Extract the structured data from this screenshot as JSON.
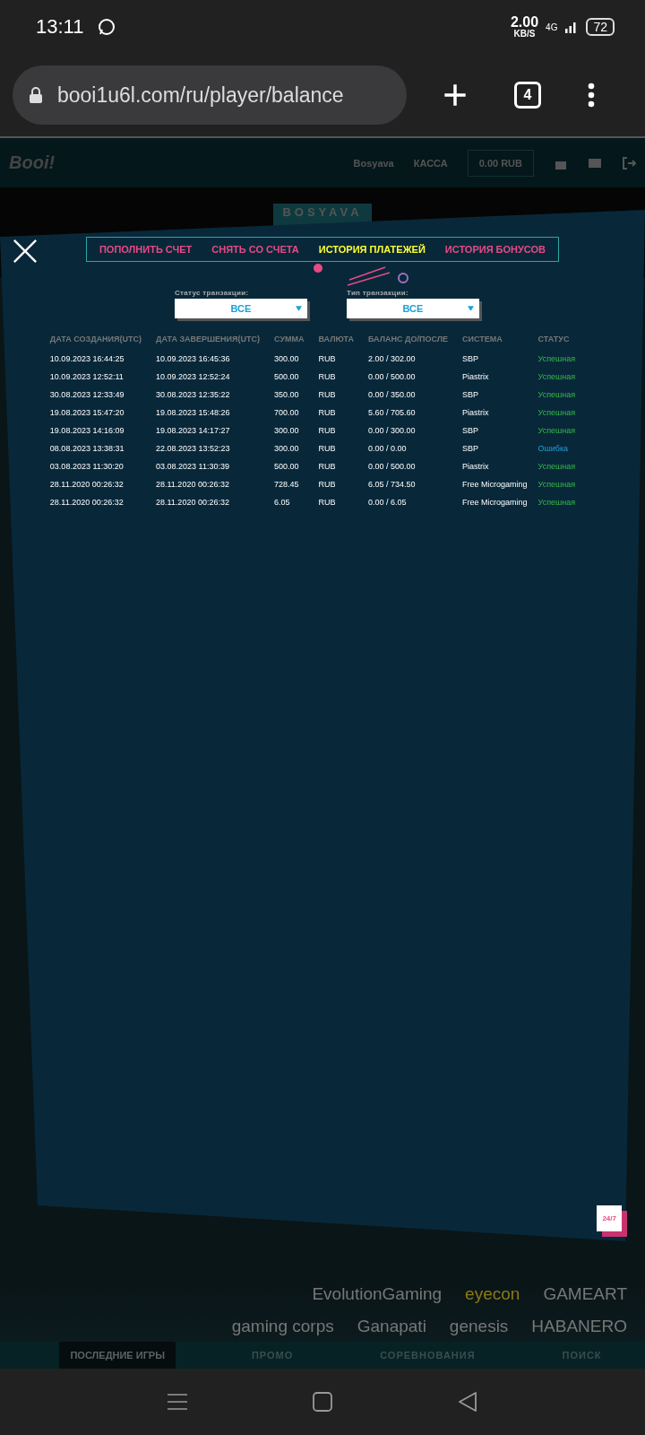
{
  "status_bar": {
    "time": "13:11",
    "speed": "2.00",
    "speed_unit": "KB/S",
    "network": "4G",
    "battery": "72"
  },
  "browser": {
    "url": "booi1u6l.com/ru/player/balance",
    "tab_count": "4"
  },
  "header": {
    "logo": "Booi!",
    "user": "Bosyava",
    "cashier": "КАССА",
    "balance": "0.00 RUB"
  },
  "banner": {
    "title": "BOSYAVA"
  },
  "modal": {
    "tabs": [
      {
        "label": "ПОПОЛНИТЬ СЧЕТ",
        "selected": false
      },
      {
        "label": "СНЯТЬ СО СЧЕТА",
        "selected": false
      },
      {
        "label": "ИСТОРИЯ ПЛАТЕЖЕЙ",
        "selected": true
      },
      {
        "label": "ИСТОРИЯ БОНУСОВ",
        "selected": false
      }
    ],
    "filters": [
      {
        "label": "Статус транзакции:",
        "value": "ВСЕ"
      },
      {
        "label": "Тип транзакции:",
        "value": "ВСЕ"
      }
    ],
    "table": {
      "columns": [
        "ДАТА СОЗДАНИЯ(UTC)",
        "ДАТА ЗАВЕРШЕНИЯ(UTC)",
        "СУММА",
        "ВАЛЮТА",
        "БАЛАНС ДО/ПОСЛЕ",
        "СИСТЕМА",
        "СТАТУС"
      ],
      "rows": [
        {
          "cells": [
            "10.09.2023 16:44:25",
            "10.09.2023 16:45:36",
            "300.00",
            "RUB",
            "2.00 / 302.00",
            "SBP",
            "Успешная"
          ],
          "kind": "success"
        },
        {
          "cells": [
            "10.09.2023 12:52:11",
            "10.09.2023 12:52:24",
            "500.00",
            "RUB",
            "0.00 / 500.00",
            "Piastrix",
            "Успешная"
          ],
          "kind": "success"
        },
        {
          "cells": [
            "30.08.2023 12:33:49",
            "30.08.2023 12:35:22",
            "350.00",
            "RUB",
            "0.00 / 350.00",
            "SBP",
            "Успешная"
          ],
          "kind": "success"
        },
        {
          "cells": [
            "19.08.2023 15:47:20",
            "19.08.2023 15:48:26",
            "700.00",
            "RUB",
            "5.60 / 705.60",
            "Piastrix",
            "Успешная"
          ],
          "kind": "success"
        },
        {
          "cells": [
            "19.08.2023 14:16:09",
            "19.08.2023 14:17:27",
            "300.00",
            "RUB",
            "0.00 / 300.00",
            "SBP",
            "Успешная"
          ],
          "kind": "success"
        },
        {
          "cells": [
            "08.08.2023 13:38:31",
            "22.08.2023 13:52:23",
            "300.00",
            "RUB",
            "0.00 / 0.00",
            "SBP",
            "Ошибка"
          ],
          "kind": "error"
        },
        {
          "cells": [
            "03.08.2023 11:30:20",
            "03.08.2023 11:30:39",
            "500.00",
            "RUB",
            "0.00 / 500.00",
            "Piastrix",
            "Успешная"
          ],
          "kind": "success"
        },
        {
          "cells": [
            "28.11.2020 00:26:32",
            "28.11.2020 00:26:32",
            "728.45",
            "RUB",
            "6.05 / 734.50",
            "Free Microgaming",
            "Успешная"
          ],
          "kind": "success"
        },
        {
          "cells": [
            "28.11.2020 00:26:32",
            "28.11.2020 00:26:32",
            "6.05",
            "RUB",
            "0.00 / 6.05",
            "Free Microgaming",
            "Успешная"
          ],
          "kind": "success"
        }
      ]
    }
  },
  "support_badge": "24/7",
  "providers": [
    [
      "EvolutionGaming",
      "eyecon",
      "GAMEART"
    ],
    [
      "gaming corps",
      "Ganapati",
      "genesis",
      "HABANERO"
    ]
  ],
  "bottom_nav": [
    {
      "label": "ПОСЛЕДНИЕ ИГРЫ",
      "selected": true
    },
    {
      "label": "ПРОМО",
      "selected": false
    },
    {
      "label": "СОРЕВНОВАНИЯ",
      "selected": false
    },
    {
      "label": "ПОИСК",
      "selected": false
    }
  ]
}
